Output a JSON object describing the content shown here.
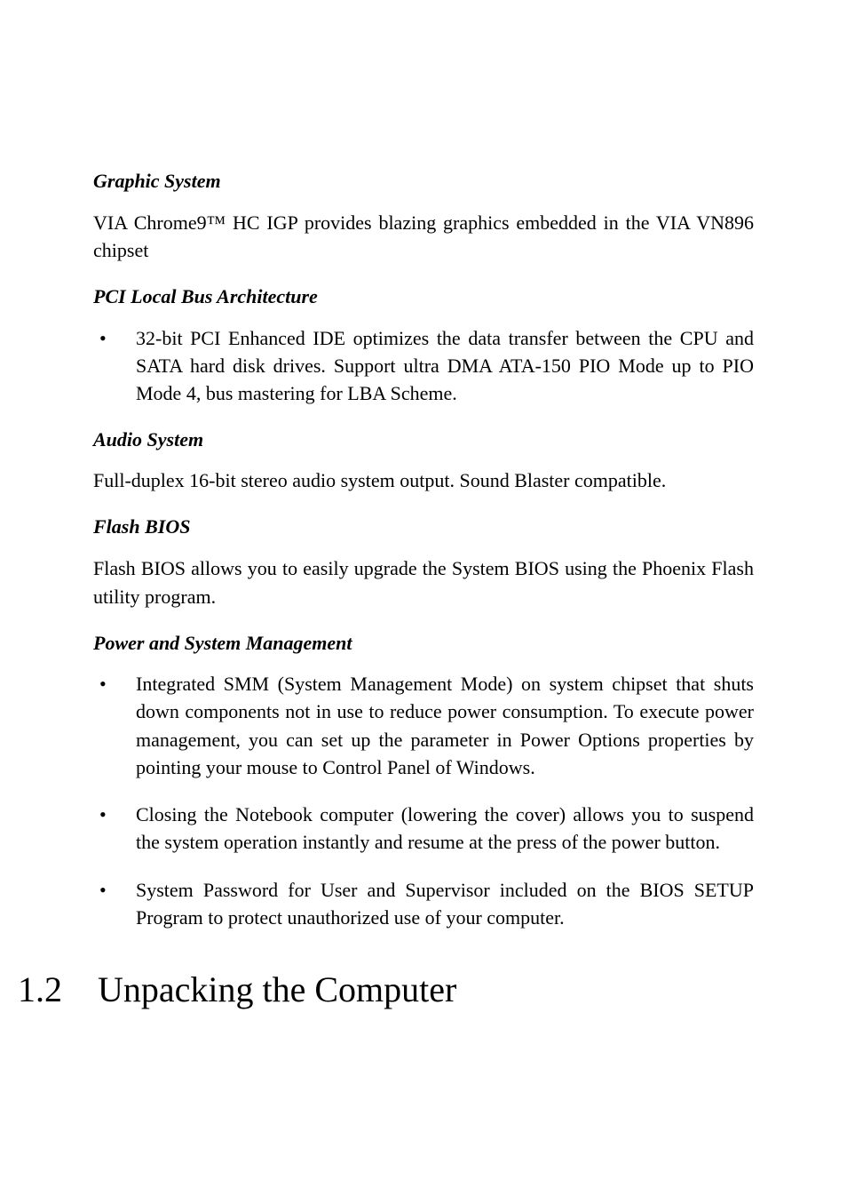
{
  "headings": {
    "graphic": "Graphic System",
    "pci": "PCI Local Bus Architecture",
    "audio": "Audio System",
    "flash": "Flash BIOS",
    "power": "Power and System Management"
  },
  "paragraphs": {
    "graphic": "VIA Chrome9™  HC IGP provides blazing graphics embedded in the VIA VN896 chipset",
    "audio": "Full-duplex 16-bit stereo audio system output. Sound Blaster compatible.",
    "flash": "Flash BIOS allows you to easily upgrade the System BIOS using the Phoenix Flash utility program."
  },
  "bullets": {
    "pci": [
      "32-bit PCI Enhanced IDE optimizes the data transfer between the CPU and SATA hard disk drives. Support ultra DMA ATA-150 PIO Mode up to PIO Mode 4, bus mastering for LBA Scheme."
    ],
    "power": [
      "Integrated SMM (System Management Mode) on system chipset that shuts down components not in use to reduce power consumption. To execute power management, you can set up the parameter in Power Options properties by pointing your mouse to Control Panel of Windows.",
      "Closing the Notebook computer (lowering the cover) allows you to suspend the system operation instantly and resume at the press of the power button.",
      "System Password for User and Supervisor included on the BIOS SETUP Program to protect unauthorized use of your computer."
    ]
  },
  "section": {
    "number": "1.2",
    "title": "Unpacking the Computer"
  }
}
